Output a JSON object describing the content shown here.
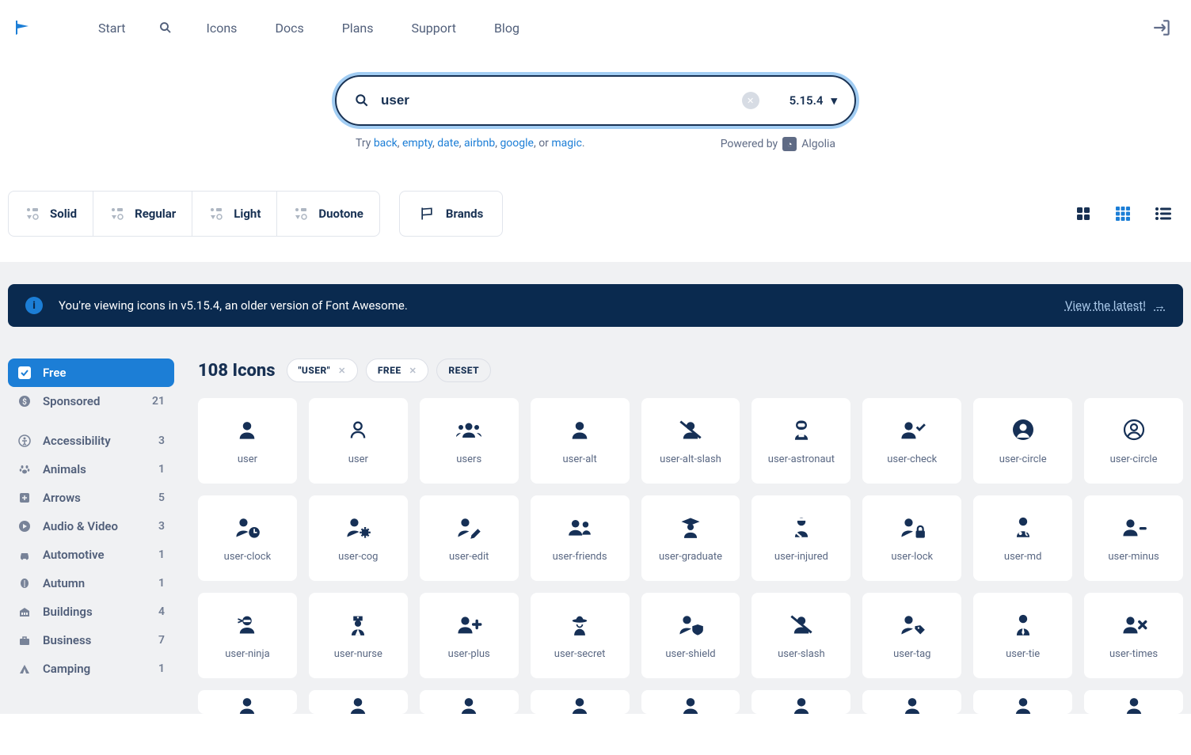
{
  "nav": {
    "items": [
      "Start",
      "__search__",
      "Icons",
      "Docs",
      "Plans",
      "Support",
      "Blog"
    ]
  },
  "search": {
    "value": "user",
    "version": "5.15.4",
    "try_label": "Try ",
    "try_links": [
      "back",
      "empty",
      "date",
      "airbnb",
      "google",
      "magic"
    ],
    "try_suffix": ", or ",
    "powered_by": "Powered by",
    "algolia": "Algolia"
  },
  "styles": [
    "Solid",
    "Regular",
    "Light",
    "Duotone"
  ],
  "brands": "Brands",
  "banner": {
    "msg": "You're viewing icons in v5.15.4, an older version of Font Awesome.",
    "link": "View the latest!"
  },
  "sidebar": [
    {
      "icon": "check",
      "label": "Free",
      "active": true
    },
    {
      "icon": "dollar",
      "label": "Sponsored",
      "count": "21"
    },
    {
      "gap": true
    },
    {
      "icon": "access",
      "label": "Accessibility",
      "count": "3"
    },
    {
      "icon": "paw",
      "label": "Animals",
      "count": "1"
    },
    {
      "icon": "arrow",
      "label": "Arrows",
      "count": "5"
    },
    {
      "icon": "play",
      "label": "Audio & Video",
      "count": "3"
    },
    {
      "icon": "car",
      "label": "Automotive",
      "count": "1"
    },
    {
      "icon": "leaf",
      "label": "Autumn",
      "count": "1"
    },
    {
      "icon": "bldg",
      "label": "Buildings",
      "count": "4"
    },
    {
      "icon": "case",
      "label": "Business",
      "count": "7"
    },
    {
      "icon": "camp",
      "label": "Camping",
      "count": "1"
    }
  ],
  "results": {
    "title": "108 Icons",
    "chips": [
      {
        "t": "\"USER\"",
        "x": true
      },
      {
        "t": "FREE",
        "x": true
      },
      {
        "t": "RESET",
        "reset": true
      }
    ]
  },
  "icons": [
    {
      "n": "user",
      "g": "user"
    },
    {
      "n": "user",
      "g": "user-o"
    },
    {
      "n": "users",
      "g": "users"
    },
    {
      "n": "user-alt",
      "g": "user"
    },
    {
      "n": "user-alt-slash",
      "g": "user-slash"
    },
    {
      "n": "user-astronaut",
      "g": "astro"
    },
    {
      "n": "user-check",
      "g": "user-check"
    },
    {
      "n": "user-circle",
      "g": "user-circle"
    },
    {
      "n": "user-circle",
      "g": "user-circle-o"
    },
    {
      "n": "user-clock",
      "g": "user-clock"
    },
    {
      "n": "user-cog",
      "g": "user-cog"
    },
    {
      "n": "user-edit",
      "g": "user-edit"
    },
    {
      "n": "user-friends",
      "g": "user-friends"
    },
    {
      "n": "user-graduate",
      "g": "user-grad"
    },
    {
      "n": "user-injured",
      "g": "user-injured"
    },
    {
      "n": "user-lock",
      "g": "user-lock"
    },
    {
      "n": "user-md",
      "g": "user-md"
    },
    {
      "n": "user-minus",
      "g": "user-minus"
    },
    {
      "n": "user-ninja",
      "g": "user-ninja"
    },
    {
      "n": "user-nurse",
      "g": "user-nurse"
    },
    {
      "n": "user-plus",
      "g": "user-plus"
    },
    {
      "n": "user-secret",
      "g": "user-secret"
    },
    {
      "n": "user-shield",
      "g": "user-shield"
    },
    {
      "n": "user-slash",
      "g": "user-slash"
    },
    {
      "n": "user-tag",
      "g": "user-tag"
    },
    {
      "n": "user-tie",
      "g": "user-tie"
    },
    {
      "n": "user-times",
      "g": "user-times"
    }
  ]
}
